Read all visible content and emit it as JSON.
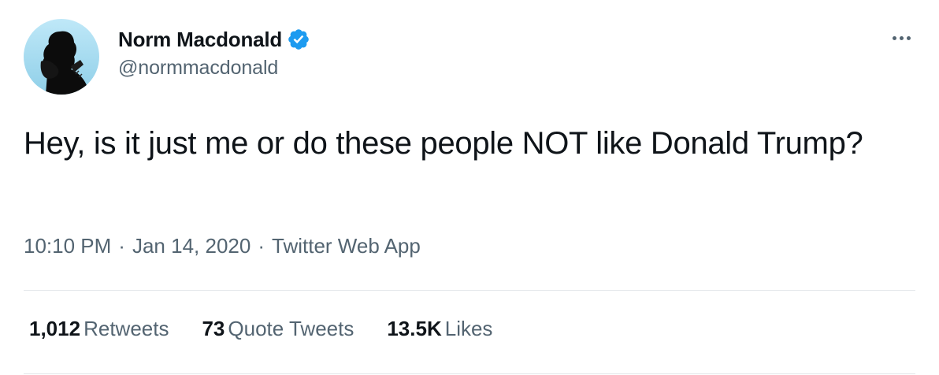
{
  "author": {
    "display_name": "Norm Macdonald",
    "handle": "@normmacdonald",
    "verified": true,
    "verified_icon": "verified-badge-icon",
    "avatar_icon": "profile-photo"
  },
  "tweet": {
    "text": "Hey, is it just me or do these people NOT like Donald Trump?",
    "time": "10:10 PM",
    "date": "Jan 14, 2020",
    "source": "Twitter Web App",
    "separator": "·"
  },
  "stats": {
    "retweets": {
      "count": "1,012",
      "label": "Retweets"
    },
    "quote_tweets": {
      "count": "73",
      "label": "Quote Tweets"
    },
    "likes": {
      "count": "13.5K",
      "label": "Likes"
    }
  },
  "more_menu_icon": "more-options-icon",
  "colors": {
    "text_primary": "#0f1419",
    "text_secondary": "#536471",
    "verified_blue": "#1d9bf0",
    "divider": "#e4e7ea",
    "avatar_sky": "#a9dcf1"
  }
}
